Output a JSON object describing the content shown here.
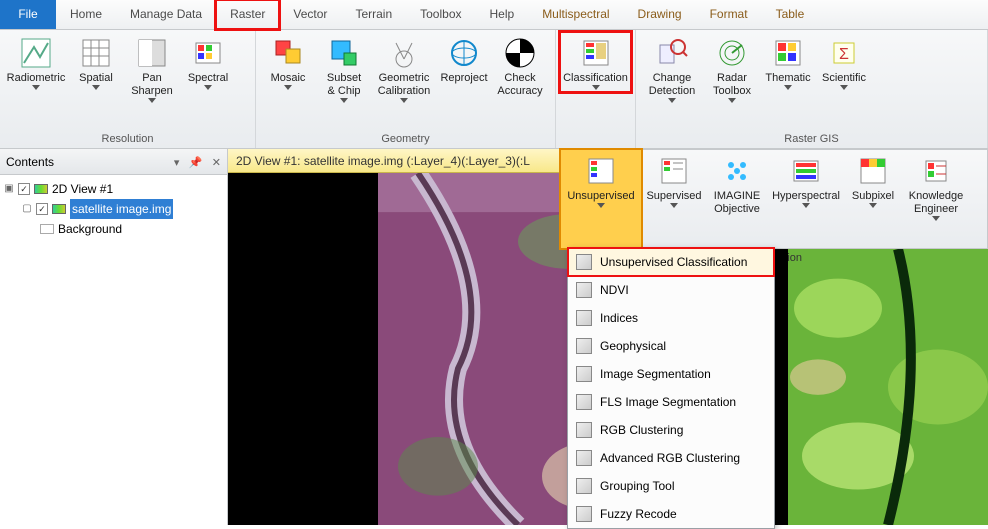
{
  "menu": {
    "file": "File",
    "home": "Home",
    "manage_data": "Manage Data",
    "raster": "Raster",
    "vector": "Vector",
    "terrain": "Terrain",
    "toolbox": "Toolbox",
    "help": "Help",
    "ctx_multispectral": "Multispectral",
    "ctx_drawing": "Drawing",
    "ctx_format": "Format",
    "ctx_table": "Table"
  },
  "ribbon1": {
    "groups": {
      "resolution": {
        "title": "Resolution",
        "tools": {
          "radiometric": "Radiometric",
          "spatial": "Spatial",
          "pan_sharpen": "Pan\nSharpen",
          "spectral": "Spectral"
        }
      },
      "geometry": {
        "title": "Geometry",
        "tools": {
          "mosaic": "Mosaic",
          "subset_chip": "Subset\n& Chip",
          "geom_cal": "Geometric\nCalibration",
          "reproject": "Reproject",
          "check_accuracy": "Check\nAccuracy"
        }
      },
      "classification": {
        "tool": "Classification"
      },
      "raster_gis": {
        "title": "Raster GIS",
        "tools": {
          "change_detect": "Change\nDetection",
          "radar_toolbox": "Radar\nToolbox",
          "thematic": "Thematic",
          "scientific": "Scientific"
        }
      }
    }
  },
  "ribbon2": {
    "tools": {
      "unsupervised": "Unsupervised",
      "supervised": "Supervised",
      "imagine_obj": "IMAGINE\nObjective",
      "hyperspectral": "Hyperspectral",
      "subpixel": "Subpixel",
      "knowledge_eng": "Knowledge\nEngineer"
    },
    "group_title": "Classification",
    "overflow_suffix": "ion"
  },
  "contents": {
    "header": "Contents",
    "tree": {
      "view_node": "2D View #1",
      "image_node": "satellite image.img",
      "background_node": "Background"
    }
  },
  "view": {
    "title": "2D View #1: satellite image.img (:Layer_4)(:Layer_3)(:L"
  },
  "dropdown": {
    "items": [
      "Unsupervised Classification",
      "NDVI",
      "Indices",
      "Geophysical",
      "Image Segmentation",
      "FLS Image Segmentation",
      "RGB Clustering",
      "Advanced RGB Clustering",
      "Grouping Tool",
      "Fuzzy Recode"
    ]
  }
}
